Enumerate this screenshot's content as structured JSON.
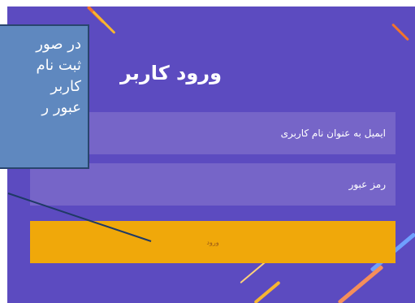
{
  "login": {
    "title": "ورود کاربر",
    "username_placeholder": "ایمیل به عنوان نام کاربری",
    "password_placeholder": "رمز عبور",
    "submit_label": "ورود"
  },
  "callout": {
    "lines": [
      "در صور",
      "ثبت نام",
      "کاربر",
      "عبور ر"
    ]
  },
  "colors": {
    "panel_bg": "#5c4bc0",
    "field_bg": "#7665c8",
    "button_bg": "#f0a80a",
    "callout_bg": "#5f88bf"
  }
}
